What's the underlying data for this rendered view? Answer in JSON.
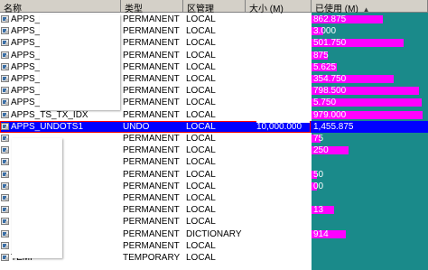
{
  "columns": {
    "name": "名称",
    "type": "类型",
    "extent": "区管理",
    "size": "大小 (M)",
    "used": "已使用 (M)"
  },
  "sort_indicator": "▲",
  "rows": [
    {
      "name": "APPS_",
      "type": "PERMANENT",
      "extent": "LOCAL",
      "size": "",
      "used": "862.875",
      "used_fraction": 0.62
    },
    {
      "name": "APPS_",
      "type": "PERMANENT",
      "extent": "LOCAL",
      "size": "",
      "used": "3.000",
      "used_fraction": 0.1
    },
    {
      "name": "APPS_",
      "type": "PERMANENT",
      "extent": "LOCAL",
      "size": "",
      "used": "501.750",
      "used_fraction": 0.8
    },
    {
      "name": "APPS_",
      "type": "PERMANENT",
      "extent": "LOCAL",
      "size": "",
      "used": "875",
      "used_fraction": 0.14
    },
    {
      "name": "APPS_",
      "type": "PERMANENT",
      "extent": "LOCAL",
      "size": "",
      "used": "5.625",
      "used_fraction": 0.22
    },
    {
      "name": "APPS_",
      "type": "PERMANENT",
      "extent": "LOCAL",
      "size": "",
      "used": "354.750",
      "used_fraction": 0.72
    },
    {
      "name": "APPS_",
      "type": "PERMANENT",
      "extent": "LOCAL",
      "size": "",
      "used": "798.500",
      "used_fraction": 0.94
    },
    {
      "name": "APPS_",
      "type": "PERMANENT",
      "extent": "LOCAL",
      "size": "",
      "used": "5.750",
      "used_fraction": 0.96
    },
    {
      "name": "APPS_TS_TX_IDX",
      "type": "PERMANENT",
      "extent": "LOCAL",
      "size": "",
      "used": "979.000",
      "used_fraction": 0.97
    },
    {
      "name": "APPS_UNDOTS1",
      "type": "UNDO",
      "extent": "LOCAL",
      "size": "10,000.000",
      "used": "1,455.875",
      "used_fraction": 0.15,
      "selected": true
    },
    {
      "name": "",
      "type": "PERMANENT",
      "extent": "LOCAL",
      "size": "",
      "used": "75",
      "used_fraction": 0.08
    },
    {
      "name": "",
      "type": "PERMANENT",
      "extent": "LOCAL",
      "size": "",
      "used": "250",
      "used_fraction": 0.32
    },
    {
      "name": "",
      "type": "PERMANENT",
      "extent": "LOCAL",
      "size": "",
      "used": "",
      "used_fraction": 0.0
    },
    {
      "name": "",
      "type": "PERMANENT",
      "extent": "LOCAL",
      "size": "",
      "used": "50",
      "used_fraction": 0.05
    },
    {
      "name": "",
      "type": "PERMANENT",
      "extent": "LOCAL",
      "size": "",
      "used": "00",
      "used_fraction": 0.05
    },
    {
      "name": "",
      "type": "PERMANENT",
      "extent": "LOCAL",
      "size": "",
      "used": "",
      "used_fraction": 0.0
    },
    {
      "name": "",
      "type": "PERMANENT",
      "extent": "LOCAL",
      "size": "",
      "used": "13",
      "used_fraction": 0.2
    },
    {
      "name": "",
      "type": "PERMANENT",
      "extent": "LOCAL",
      "size": "",
      "used": "",
      "used_fraction": 0.0
    },
    {
      "name": "",
      "type": "PERMANENT",
      "extent": "DICTIONARY",
      "size": "",
      "used": "914",
      "used_fraction": 0.3
    },
    {
      "name": "",
      "type": "PERMANENT",
      "extent": "LOCAL",
      "size": "",
      "used": "",
      "used_fraction": 0.0
    },
    {
      "name": "TEMP",
      "type": "TEMPORARY",
      "extent": "LOCAL",
      "size": "",
      "used": "",
      "used_fraction": 0.0
    }
  ],
  "colors": {
    "header_bg": "#d4d0c8",
    "selection_bg": "#0000ff",
    "selection_border": "#ff0000",
    "used_bg": "#1a8a8a",
    "used_bar": "#ff00ff"
  }
}
